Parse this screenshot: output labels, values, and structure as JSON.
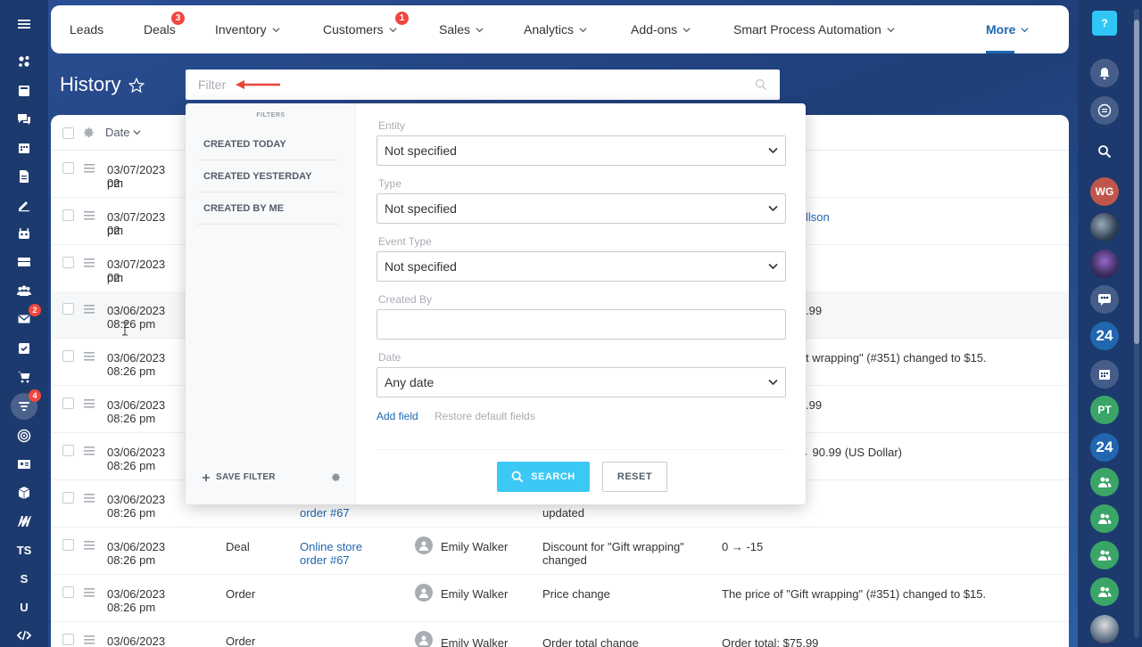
{
  "nav": {
    "items": [
      {
        "label": "Leads",
        "badge": ""
      },
      {
        "label": "Deals",
        "badge": "3"
      },
      {
        "label": "Inventory",
        "badge": ""
      },
      {
        "label": "Customers",
        "badge": "1"
      },
      {
        "label": "Sales",
        "badge": ""
      },
      {
        "label": "Analytics",
        "badge": ""
      },
      {
        "label": "Add-ons",
        "badge": ""
      },
      {
        "label": "Smart Process Automation",
        "badge": ""
      },
      {
        "label": "More",
        "badge": ""
      }
    ]
  },
  "left_sidebar": {
    "badges": {
      "mail": "2",
      "funnel": "4"
    },
    "text_items": [
      "TS",
      "S",
      "U"
    ]
  },
  "right_sidebar": {
    "help": "?",
    "avatars": [
      "WG",
      "PT"
    ],
    "brand": "24"
  },
  "page": {
    "title": "History"
  },
  "filter": {
    "placeholder": "Filter"
  },
  "table": {
    "header_date": "Date",
    "rows": [
      {
        "date": "03/07/2023 02:",
        "time": "pm",
        "entity": "",
        "entity_link": "",
        "entity_link2": "",
        "user": "",
        "event": "",
        "event2": "",
        "details": "",
        "details_link": ""
      },
      {
        "date": "03/07/2023 02:",
        "time": "pm",
        "entity": "",
        "entity_link": "",
        "entity_link2": "",
        "user": "",
        "event": "",
        "event2": "",
        "details": "",
        "details_link": "llson"
      },
      {
        "date": "03/07/2023 02:",
        "time": "pm",
        "entity": "",
        "entity_link": "",
        "entity_link2": "",
        "user": "",
        "event": "",
        "event2": "",
        "details": "",
        "details_link": ""
      },
      {
        "date": "03/06/2023",
        "time": "08:26 pm",
        "entity": "",
        "entity_link": "",
        "entity_link2": "",
        "user": "",
        "event": "",
        "event2": "",
        "details": ".99",
        "details_link": ""
      },
      {
        "date": "03/06/2023",
        "time": "08:26 pm",
        "entity": "",
        "entity_link": "",
        "entity_link2": "",
        "user": "",
        "event": "",
        "event2": "",
        "details": "t wrapping\" (#351) changed to $15.",
        "details_link": ""
      },
      {
        "date": "03/06/2023",
        "time": "08:26 pm",
        "entity": "",
        "entity_link": "",
        "entity_link2": "",
        "user": "",
        "event": "",
        "event2": "",
        "details": ".99",
        "details_link": ""
      },
      {
        "date": "03/06/2023",
        "time": "08:26 pm",
        "entity": "",
        "entity_link": "",
        "entity_link2": "",
        "user": "",
        "event": "",
        "event2": "",
        "details": ") → 90.99 (US Dollar)",
        "details_link": ""
      },
      {
        "date": "03/06/2023",
        "time": "08:26 pm",
        "entity": "",
        "entity_link": "",
        "entity_link2": "order #67",
        "user": "",
        "event": "",
        "event2": "updated",
        "details": "",
        "details_link": ""
      },
      {
        "date": "03/06/2023",
        "time": "08:26 pm",
        "entity": "Deal",
        "entity_link": "Online store",
        "entity_link2": "order #67",
        "user": "Emily Walker",
        "event": "Discount for \"Gift wrapping\"",
        "event2": "changed",
        "details": "0 → -15",
        "details_link": ""
      },
      {
        "date": "03/06/2023",
        "time": "08:26 pm",
        "entity": "Order",
        "entity_link": "",
        "entity_link2": "",
        "user": "Emily Walker",
        "event": "Price change",
        "event2": "",
        "details": "The price of \"Gift wrapping\" (#351) changed to $15.",
        "details_link": ""
      },
      {
        "date": "03/06/2023",
        "time": "",
        "entity": "Order",
        "entity_link": "",
        "entity_link2": "",
        "user": "Emily Walker",
        "event": "Order total change",
        "event2": "",
        "details": "Order total: $75.99",
        "details_link": ""
      }
    ]
  },
  "popup": {
    "filters_title": "FILTERS",
    "presets": [
      "CREATED TODAY",
      "CREATED YESTERDAY",
      "CREATED BY ME"
    ],
    "save_filter": "SAVE FILTER",
    "fields": [
      {
        "label": "Entity",
        "value": "Not specified",
        "type": "select"
      },
      {
        "label": "Type",
        "value": "Not specified",
        "type": "select"
      },
      {
        "label": "Event Type",
        "value": "Not specified",
        "type": "select"
      },
      {
        "label": "Created By",
        "value": "",
        "type": "text"
      },
      {
        "label": "Date",
        "value": "Any date",
        "type": "select"
      }
    ],
    "add_field": "Add field",
    "restore": "Restore default fields",
    "search_label": "SEARCH",
    "reset_label": "RESET"
  },
  "colors": {
    "accent": "#2067b0",
    "search_button": "#3bc8f5",
    "badge": "#f0483e"
  }
}
